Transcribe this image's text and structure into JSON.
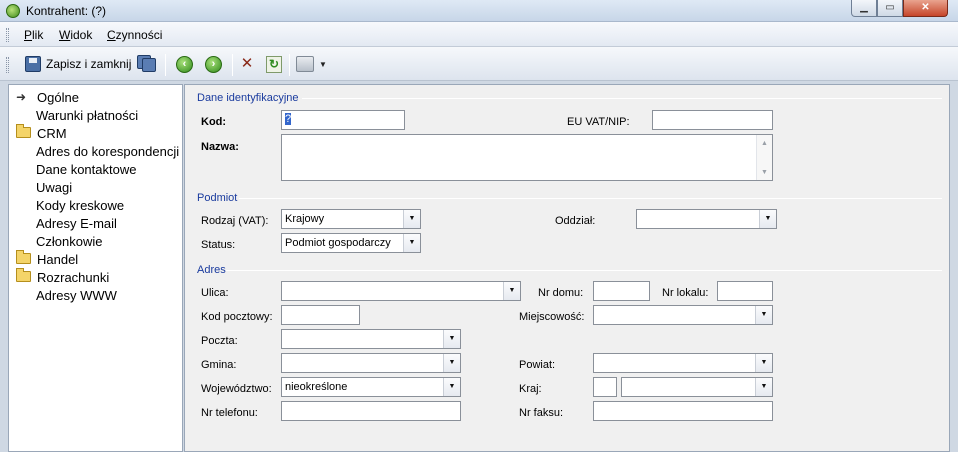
{
  "window": {
    "title": "Kontrahent:  (?)"
  },
  "menu": {
    "items": [
      "Plik",
      "Widok",
      "Czynności"
    ]
  },
  "toolbar": {
    "save_close_label": "Zapisz i zamknij"
  },
  "tree": {
    "items": [
      {
        "label": "Ogólne",
        "type": "pointer"
      },
      {
        "label": "Warunki płatności",
        "type": "child"
      },
      {
        "label": "CRM",
        "type": "folder"
      },
      {
        "label": "Adres do korespondencji",
        "type": "child"
      },
      {
        "label": "Dane kontaktowe",
        "type": "child"
      },
      {
        "label": "Uwagi",
        "type": "child"
      },
      {
        "label": "Kody kreskowe",
        "type": "child"
      },
      {
        "label": "Adresy E-mail",
        "type": "child"
      },
      {
        "label": "Członkowie",
        "type": "child"
      },
      {
        "label": "Handel",
        "type": "folder"
      },
      {
        "label": "Rozrachunki",
        "type": "folder"
      },
      {
        "label": "Adresy WWW",
        "type": "child"
      }
    ]
  },
  "sections": {
    "identyfikacja": "Dane identyfikacyjne",
    "podmiot": "Podmiot",
    "adres": "Adres"
  },
  "fields": {
    "kod": {
      "label": "Kod:",
      "value": "?"
    },
    "eu_vat": {
      "label": "EU VAT/NIP:",
      "value": ""
    },
    "nazwa": {
      "label": "Nazwa:",
      "value": ""
    },
    "rodzaj": {
      "label": "Rodzaj (VAT):",
      "value": "Krajowy"
    },
    "oddzial": {
      "label": "Oddział:",
      "value": ""
    },
    "status": {
      "label": "Status:",
      "value": "Podmiot gospodarczy"
    },
    "ulica": {
      "label": "Ulica:",
      "value": ""
    },
    "nr_domu": {
      "label": "Nr domu:",
      "value": ""
    },
    "nr_lokalu": {
      "label": "Nr lokalu:",
      "value": ""
    },
    "kod_pocztowy": {
      "label": "Kod pocztowy:",
      "value": ""
    },
    "miejscowosc": {
      "label": "Miejscowość:",
      "value": ""
    },
    "poczta": {
      "label": "Poczta:",
      "value": ""
    },
    "gmina": {
      "label": "Gmina:",
      "value": ""
    },
    "powiat": {
      "label": "Powiat:",
      "value": ""
    },
    "wojewodztwo": {
      "label": "Województwo:",
      "value": "nieokreślone"
    },
    "kraj": {
      "label": "Kraj:",
      "value": ""
    },
    "nr_telefonu": {
      "label": "Nr telefonu:",
      "value": ""
    },
    "nr_faksu": {
      "label": "Nr faksu:",
      "value": ""
    }
  }
}
